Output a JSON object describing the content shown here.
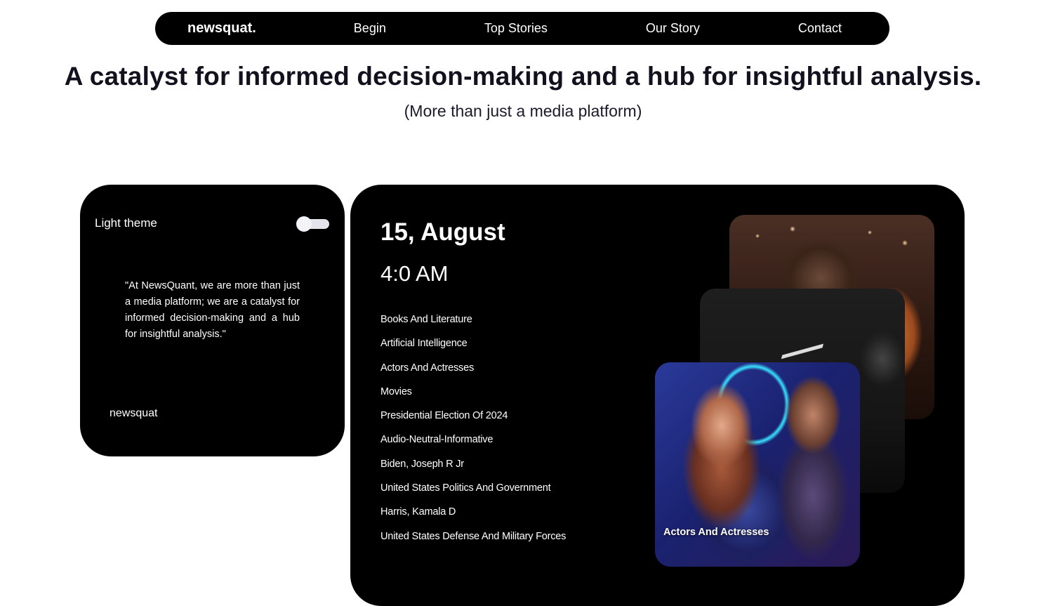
{
  "nav": {
    "brand": "newsquat.",
    "links": [
      "Begin",
      "Top Stories",
      "Our Story",
      "Contact"
    ]
  },
  "hero": {
    "headline": "A catalyst for informed decision-making and a hub for insightful analysis.",
    "subhead": "(More than just a media platform)"
  },
  "theme_card": {
    "theme_label": "Light theme",
    "quote": "\"At NewsQuant, we are more than just a media platform; we are a catalyst for informed decision-making and a hub for insightful analysis.\"",
    "signature": "newsquat"
  },
  "main_card": {
    "date": "15, August",
    "time": "4:0 AM",
    "topics": [
      "Books And Literature",
      "Artificial Intelligence",
      "Actors And Actresses",
      "Movies",
      "Presidential Election Of 2024",
      "Audio-Neutral-Informative",
      "Biden, Joseph R Jr",
      "United States Politics And Government",
      "Harris, Kamala D",
      "United States Defense And Military Forces"
    ],
    "featured_caption": "Actors And Actresses"
  }
}
